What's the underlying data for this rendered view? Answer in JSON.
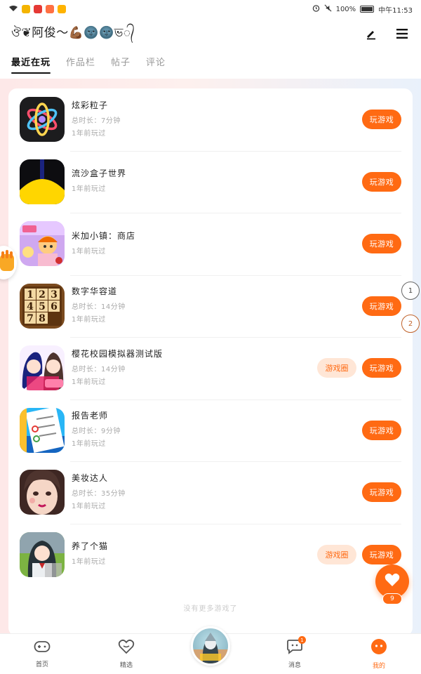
{
  "status_bar": {
    "battery": "100%",
    "time": "中午11:53"
  },
  "header": {
    "username": "ঔ❦阿俊〜💪🏾🌚🌚ভ᭄"
  },
  "tabs": [
    {
      "label": "最近在玩",
      "active": true
    },
    {
      "label": "作品栏",
      "active": false
    },
    {
      "label": "帖子",
      "active": false
    },
    {
      "label": "评论",
      "active": false
    }
  ],
  "games": [
    {
      "name": "炫彩粒子",
      "duration": "总时长：7分钟",
      "last_played": "1年前玩过",
      "icon": "particle-atom-icon",
      "has_circle": false
    },
    {
      "name": "流沙盒子世界",
      "duration": "",
      "last_played": "1年前玩过",
      "icon": "sand-pyramid-icon",
      "has_circle": false
    },
    {
      "name": "米加小镇：商店",
      "duration": "",
      "last_played": "1年前玩过",
      "icon": "toca-shop-icon",
      "has_circle": false
    },
    {
      "name": "数字华容道",
      "duration": "总时长：14分钟",
      "last_played": "1年前玩过",
      "icon": "number-puzzle-icon",
      "has_circle": false
    },
    {
      "name": "樱花校园模拟器测试版",
      "duration": "总时长：14分钟",
      "last_played": "1年前玩过",
      "icon": "sakura-school-icon",
      "has_circle": true
    },
    {
      "name": "报告老师",
      "duration": "总时长：9分钟",
      "last_played": "1年前玩过",
      "icon": "report-teacher-icon",
      "has_circle": false
    },
    {
      "name": "美妆达人",
      "duration": "总时长：35分钟",
      "last_played": "1年前玩过",
      "icon": "makeup-icon",
      "has_circle": false
    },
    {
      "name": "养了个猫",
      "duration": "",
      "last_played": "1年前玩过",
      "icon": "cat-game-icon",
      "has_circle": true
    }
  ],
  "buttons": {
    "play": "玩游戏",
    "circle": "游戏圈"
  },
  "no_more": "没有更多游戏了",
  "heart_count": "9",
  "side_markers": [
    "1",
    "2"
  ],
  "bottom_nav": [
    {
      "label": "首页",
      "icon": "gamepad-icon"
    },
    {
      "label": "精选",
      "icon": "heart-chat-icon"
    },
    {
      "label": "",
      "icon": "center-avatar"
    },
    {
      "label": "消息",
      "icon": "message-icon",
      "badge": "1"
    },
    {
      "label": "我的",
      "icon": "profile-face-icon",
      "active": true
    }
  ],
  "colors": {
    "accent": "#ff6a13",
    "accent_light": "#ffe6d6"
  }
}
